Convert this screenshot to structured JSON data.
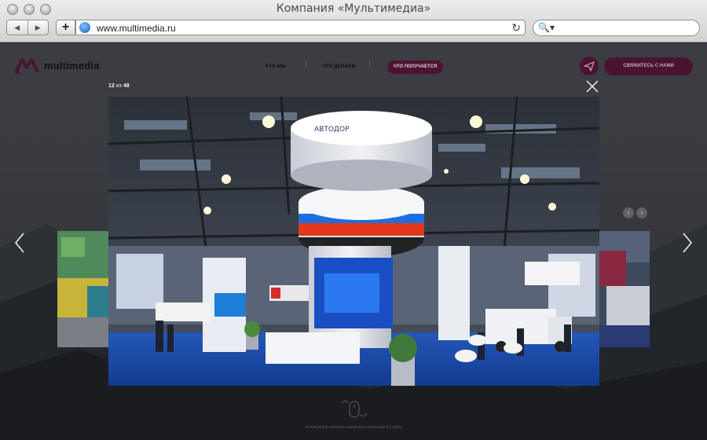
{
  "browser": {
    "window_title": "Компания «Мультимедиа»",
    "url": "www.multimedia.ru",
    "back_icon": "back-arrow-icon",
    "forward_icon": "forward-arrow-icon",
    "add_icon": "plus-icon",
    "reload_icon": "reload-icon",
    "search_icon": "search-icon"
  },
  "site": {
    "logo_text": "multimedia",
    "nav": {
      "who": "КТО МЫ",
      "what": "ЧТО ДЕЛАЕМ",
      "result": "ЧТО ПОЛУЧАЕТСЯ"
    },
    "contact_label": "СВЯЖИТЕСЬ С НАМИ",
    "accent_color": "#4a1431"
  },
  "gallery": {
    "current": "12",
    "of_label": "из",
    "total": "48",
    "image_description_icon": "photo-exhibition-stand",
    "scroll_hint": "используйте колесико мыши для навигации по сайту"
  }
}
